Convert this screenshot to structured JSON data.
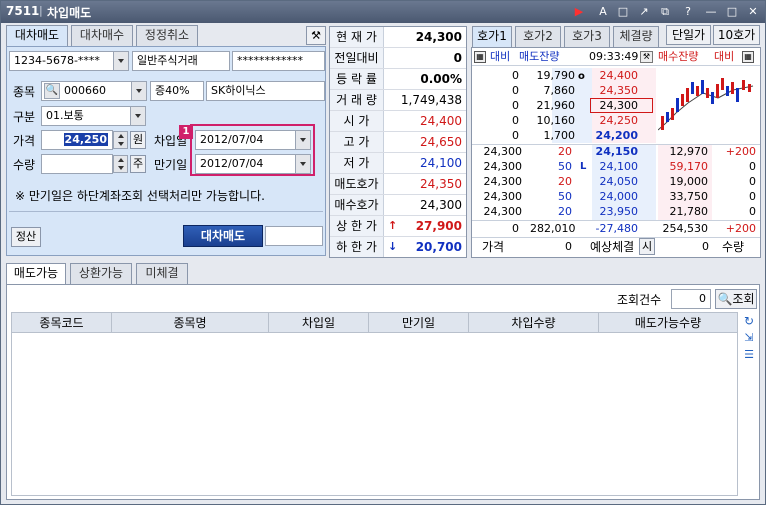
{
  "window": {
    "code": "7511",
    "title": "차입매도"
  },
  "title_buttons": [
    "▶",
    "A",
    "□",
    "↗",
    "⧉",
    "?",
    "—",
    "□",
    "✕"
  ],
  "top_tabs": [
    "대차매도",
    "대차매수",
    "정정취소"
  ],
  "account": {
    "number": "1234-5678-****",
    "type": "일반주식거래",
    "password": "************"
  },
  "stock": {
    "label": "종목",
    "code": "000660",
    "margin": "증40%",
    "name": "SK하이닉스"
  },
  "category": {
    "label": "구분",
    "value": "01.보통"
  },
  "price": {
    "label": "가격",
    "value": "24,250",
    "unit": "원"
  },
  "quantity": {
    "label": "수량",
    "value": "",
    "unit": "주"
  },
  "borrow_date": {
    "label": "차입일",
    "value": "2012/07/04"
  },
  "expire_date": {
    "label": "만기일",
    "value": "2012/07/04"
  },
  "badge": "1",
  "note": "※ 만기일은 하단계좌조회 선택처리만 가능합니다.",
  "settle_button": "정산",
  "order_button": "대차매도",
  "quote": {
    "rows": [
      {
        "label": "현 재 가",
        "value": "24,300",
        "color": "#000000"
      },
      {
        "label": "전일대비",
        "value": "0",
        "color": "#000000"
      },
      {
        "label": "등 락 률",
        "value": "0.00%",
        "color": "#000000"
      },
      {
        "label": "거 래 량",
        "value": "1,749,438",
        "color": "#000000"
      },
      {
        "label": "시 가",
        "value": "24,400",
        "color": "#d01818"
      },
      {
        "label": "고 가",
        "value": "24,650",
        "color": "#d01818"
      },
      {
        "label": "저 가",
        "value": "24,100",
        "color": "#1030c0"
      },
      {
        "label": "매도호가",
        "value": "24,350",
        "color": "#d01818"
      },
      {
        "label": "매수호가",
        "value": "24,300",
        "color": "#000000"
      },
      {
        "label": "상 한 가",
        "value": "27,900",
        "color": "#d01818",
        "arrow": "↑"
      },
      {
        "label": "하 한 가",
        "value": "20,700",
        "color": "#1030c0",
        "arrow": "↓"
      }
    ]
  },
  "hoga": {
    "tabs": [
      "호가1",
      "호가2",
      "호가3",
      "체결량"
    ],
    "single_button": "단일가",
    "ten_button": "10호가",
    "header": {
      "compare": "대비",
      "sell_rem": "매도잔량",
      "time": "09:33:49",
      "buy_rem": "매수잔량",
      "compare2": "대비"
    },
    "sell_rows": [
      {
        "diff": "0",
        "qty": "19,790",
        "price": "24,400"
      },
      {
        "diff": "0",
        "qty": "7,860",
        "price": "24,350"
      },
      {
        "diff": "0",
        "qty": "21,960",
        "price": "24,300"
      },
      {
        "diff": "0",
        "qty": "10,160",
        "price": "24,250"
      },
      {
        "diff": "0",
        "qty": "1,700",
        "price": "24,200"
      }
    ],
    "buy_rows": [
      {
        "left": "24,300",
        "vol": "20",
        "price": "24,150",
        "qty": "12,970",
        "diff": "+200"
      },
      {
        "left": "24,300",
        "vol": "50",
        "price": "24,100",
        "qty": "59,170",
        "diff": "0"
      },
      {
        "left": "24,300",
        "vol": "20",
        "price": "24,050",
        "qty": "19,000",
        "diff": "0"
      },
      {
        "left": "24,300",
        "vol": "50",
        "price": "24,000",
        "qty": "33,750",
        "diff": "0"
      },
      {
        "left": "24,300",
        "vol": "20",
        "price": "23,950",
        "qty": "21,780",
        "diff": "0"
      }
    ],
    "marker_o": "o",
    "marker_l": "L",
    "totals": {
      "diff": "0",
      "sell_total": "282,010",
      "net": "-27,480",
      "buy_total": "254,530",
      "change": "+200"
    },
    "footer": {
      "price_label": "가격",
      "price_value": "0",
      "expected_label": "예상체결",
      "time_label": "시",
      "qty_value": "0",
      "qty_label": "수량"
    }
  },
  "bottom_tabs": [
    "매도가능",
    "상환가능",
    "미체결"
  ],
  "query": {
    "count_label": "조회건수",
    "count_value": "0",
    "search_button": "조회"
  },
  "grid_headers": [
    "종목코드",
    "종목명",
    "차입일",
    "만기일",
    "차입수량",
    "매도가능수량"
  ]
}
